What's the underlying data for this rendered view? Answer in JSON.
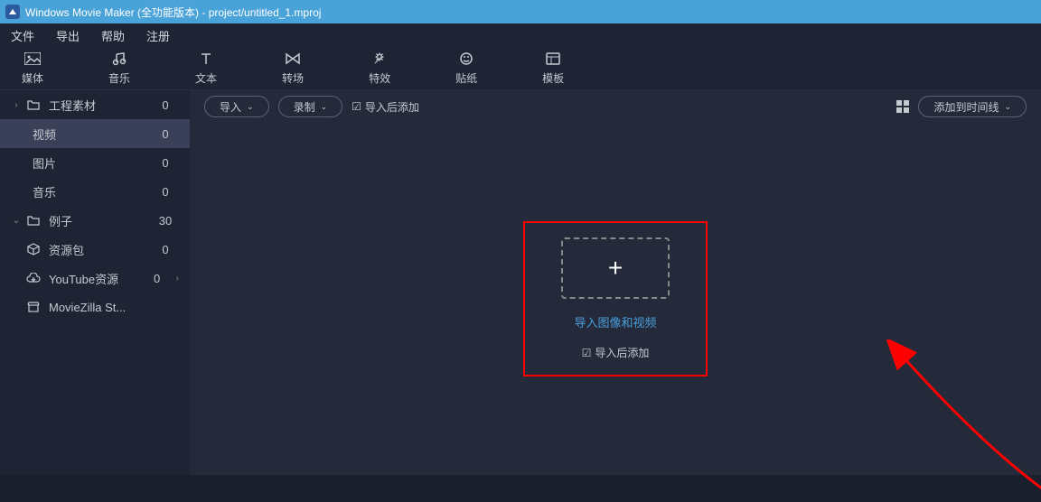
{
  "titlebar": {
    "app_name": "Windows Movie Maker (全功能版本)",
    "project_path": "project/untitled_1.mproj"
  },
  "menubar": {
    "file": "文件",
    "export": "导出",
    "help": "帮助",
    "register": "注册"
  },
  "toolbar": {
    "media": "媒体",
    "music": "音乐",
    "text": "文本",
    "transition": "转场",
    "effects": "特效",
    "stickers": "贴纸",
    "templates": "模板"
  },
  "sidebar": {
    "project_assets": {
      "label": "工程素材",
      "count": "0"
    },
    "video": {
      "label": "视频",
      "count": "0"
    },
    "image": {
      "label": "图片",
      "count": "0"
    },
    "music": {
      "label": "音乐",
      "count": "0"
    },
    "examples": {
      "label": "例子",
      "count": "30"
    },
    "resource_pack": {
      "label": "资源包",
      "count": "0"
    },
    "youtube": {
      "label": "YouTube资源",
      "count": "0"
    },
    "moviezilla": {
      "label": "MovieZilla St..."
    }
  },
  "main_toolbar": {
    "import": "导入",
    "record": "录制",
    "add_after_import": "导入后添加",
    "add_to_timeline": "添加到时间线"
  },
  "dropzone": {
    "import_link": "导入图像和视频",
    "add_after_import": "导入后添加"
  }
}
